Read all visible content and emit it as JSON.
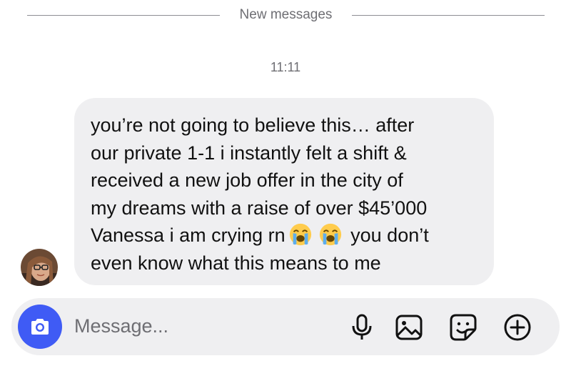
{
  "divider": {
    "label": "New messages"
  },
  "timestamp": "11:11",
  "message": {
    "line1": "you’re not going to believe this… after",
    "line2": "our private 1-1 i instantly felt a shift &",
    "line3": "received a new job offer in the city of",
    "line4": "my dreams with a raise of over $45’000",
    "line5_before": "Vanessa i am crying rn",
    "line5_after": "you don’t",
    "line6": "even know what this means to me",
    "emojis": [
      "loudly-crying-face",
      "loudly-crying-face"
    ]
  },
  "composer": {
    "placeholder": "Message...",
    "icons": [
      "camera-icon",
      "microphone-icon",
      "gallery-icon",
      "sticker-icon",
      "add-icon"
    ]
  },
  "colors": {
    "accent": "#3f5bf5",
    "bubble": "#efeff1",
    "secondary_text": "#6e6e73"
  }
}
